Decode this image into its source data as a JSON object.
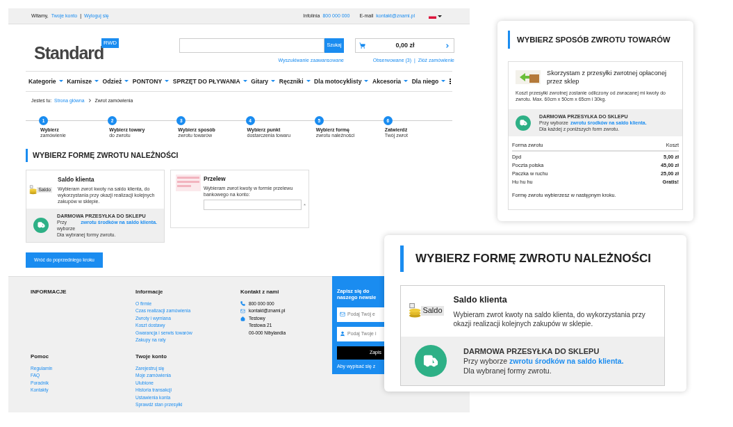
{
  "top_bar": {
    "greeting": "Witamy,",
    "account_link": "Twoje konto",
    "separator": "|",
    "logout_link": "Wyloguj się",
    "hotline_label": "Infolinia",
    "hotline": "800 000 000",
    "email_label": "E-mail",
    "email": "kontakt@znami.pl"
  },
  "header": {
    "logo": "Standard",
    "logo_badge": "RWD",
    "search_button": "Szukaj",
    "advanced_search": "Wyszukiwanie zaawansowane",
    "cart_total": "0,00 zł",
    "watched_link": "Obserwowane (3)",
    "separator": "|",
    "order_link": "Złóż zamówienie"
  },
  "nav": [
    "Kategorie",
    "Karnisze",
    "Odzież",
    "PONTONY",
    "SPRZĘT DO PŁYWANIA",
    "Gitary",
    "Ręczniki",
    "Dla motocyklisty",
    "Akcesoria",
    "Dla niego"
  ],
  "breadcrumb": {
    "label": "Jesteś tu:",
    "items": [
      "Strona główna",
      "Zwrot zamówienia"
    ]
  },
  "steps": [
    {
      "number": "1",
      "title": "Wybierz",
      "subtitle": "zamówienie"
    },
    {
      "number": "2",
      "title": "Wybierz towary",
      "subtitle": "do zwrotu"
    },
    {
      "number": "3",
      "title": "Wybierz sposób",
      "subtitle": "zwrotu towarów"
    },
    {
      "number": "4",
      "title": "Wybierz punkt",
      "subtitle": "dostarczenia towaru"
    },
    {
      "number": "5",
      "title": "Wybierz formę",
      "subtitle": "zwrotu należności"
    },
    {
      "number": "6",
      "title": "Zatwierdź",
      "subtitle": "Twój zwrot"
    }
  ],
  "section_title": "WYBIERZ FORMĘ ZWROTU NALEŻNOŚCI",
  "options": [
    {
      "kind": "saldo",
      "title": "Saldo klienta",
      "description": "Wybieram zwrot kwoty na saldo klienta, do wykorzystania przy okazji realizacji kolejnych zakupów w sklepie.",
      "shipping": {
        "title": "DARMOWA PRZESYŁKA DO SKLEPU",
        "text_before": "Przy wyborze",
        "link": "zwrotu środków na saldo klienta.",
        "text_after": "Dla wybranej formy zwrotu."
      }
    },
    {
      "kind": "transfer",
      "title": "Przelew",
      "description": "Wybieram zwrot kwoty w formie przelewu bankowego na konto:",
      "required_mark": "*"
    }
  ],
  "back_button": "Wróć do poprzedniego kroku",
  "footer": {
    "columns": [
      {
        "title": "INFORMACJE"
      },
      {
        "title": "Informacje",
        "links": [
          "O firmie",
          "Czas realizacji zamówienia",
          "Zwroty i wymiana",
          "Koszt dostawy",
          "Gwarancja i serwis towarów",
          "Zakupy na raty"
        ]
      },
      {
        "title": "Pomoc",
        "links": [
          "Regulamin",
          "FAQ",
          "Poradnik",
          "Kontakty"
        ]
      },
      {
        "title": "Twoje konto",
        "links": [
          "Zarejestruj się",
          "Moje zamówienia",
          "Ulubione",
          "Historia transakcji",
          "Ustawienia konta",
          "Sprawdź stan przesyłki"
        ]
      }
    ],
    "contact": {
      "title": "Kontakt z nami",
      "phone": "800 000 000",
      "email": "kontakt@znami.pl",
      "address": [
        "Testowy",
        "Testowa 21",
        "00-000 Nibylandia"
      ]
    },
    "newsletter": {
      "title_lines": [
        "Zapisz się do",
        "naszego newsle"
      ],
      "email_placeholder": "Podaj Twój e",
      "name_placeholder": "Podaj Twoje i",
      "submit": "Zapis",
      "unsubscribe": "Aby wypisać się z"
    }
  },
  "return_method_card": {
    "title": "WYBIERZ SPOSÓB ZWROTU TOWARÓW",
    "option_title": "Skorzystam z przesyłki zwrotnej opłaconej przez sklep",
    "option_description": "Koszt przesyłki zwrotnej zostanie odliczony od zwracanej mi kwoty do zwrotu. Max. 60cm x 50cm x 65cm i 30kg.",
    "shipping": {
      "title": "DARMOWA PRZESYŁKA DO SKLEPU",
      "text_before": "Przy wyborze",
      "link": "zwrotu środków na saldo klienta.",
      "text_after": "Dla każdej z poniższych form zwrotu."
    },
    "table": {
      "columns": [
        "Forma zwrotu",
        "Koszt"
      ],
      "rows": [
        [
          "Dpd",
          "5,00 zł"
        ],
        [
          "Poczta polska",
          "45,00 zł"
        ],
        [
          "Paczka w ruchu",
          "25,00 zł"
        ],
        [
          "Hu hu hu",
          "Gratis!"
        ]
      ]
    },
    "note": "Formę zwrotu wybierzesz w następnym kroku."
  },
  "refund_form_card": {
    "title": "WYBIERZ FORMĘ ZWROTU NALEŻNOŚCI",
    "option_title": "Saldo klienta",
    "badge": "Saldo",
    "option_description": "Wybieram zwrot kwoty na saldo klienta, do wykorzystania przy okazji realizacji kolejnych zakupów w sklepie.",
    "shipping": {
      "title": "DARMOWA PRZESYŁKA DO SKLEPU",
      "text_before": "Przy wyborze",
      "link": "zwrotu środków na saldo klienta.",
      "text_after": "Dla wybranej formy zwrotu."
    }
  },
  "saldo_badge": "Saldo"
}
